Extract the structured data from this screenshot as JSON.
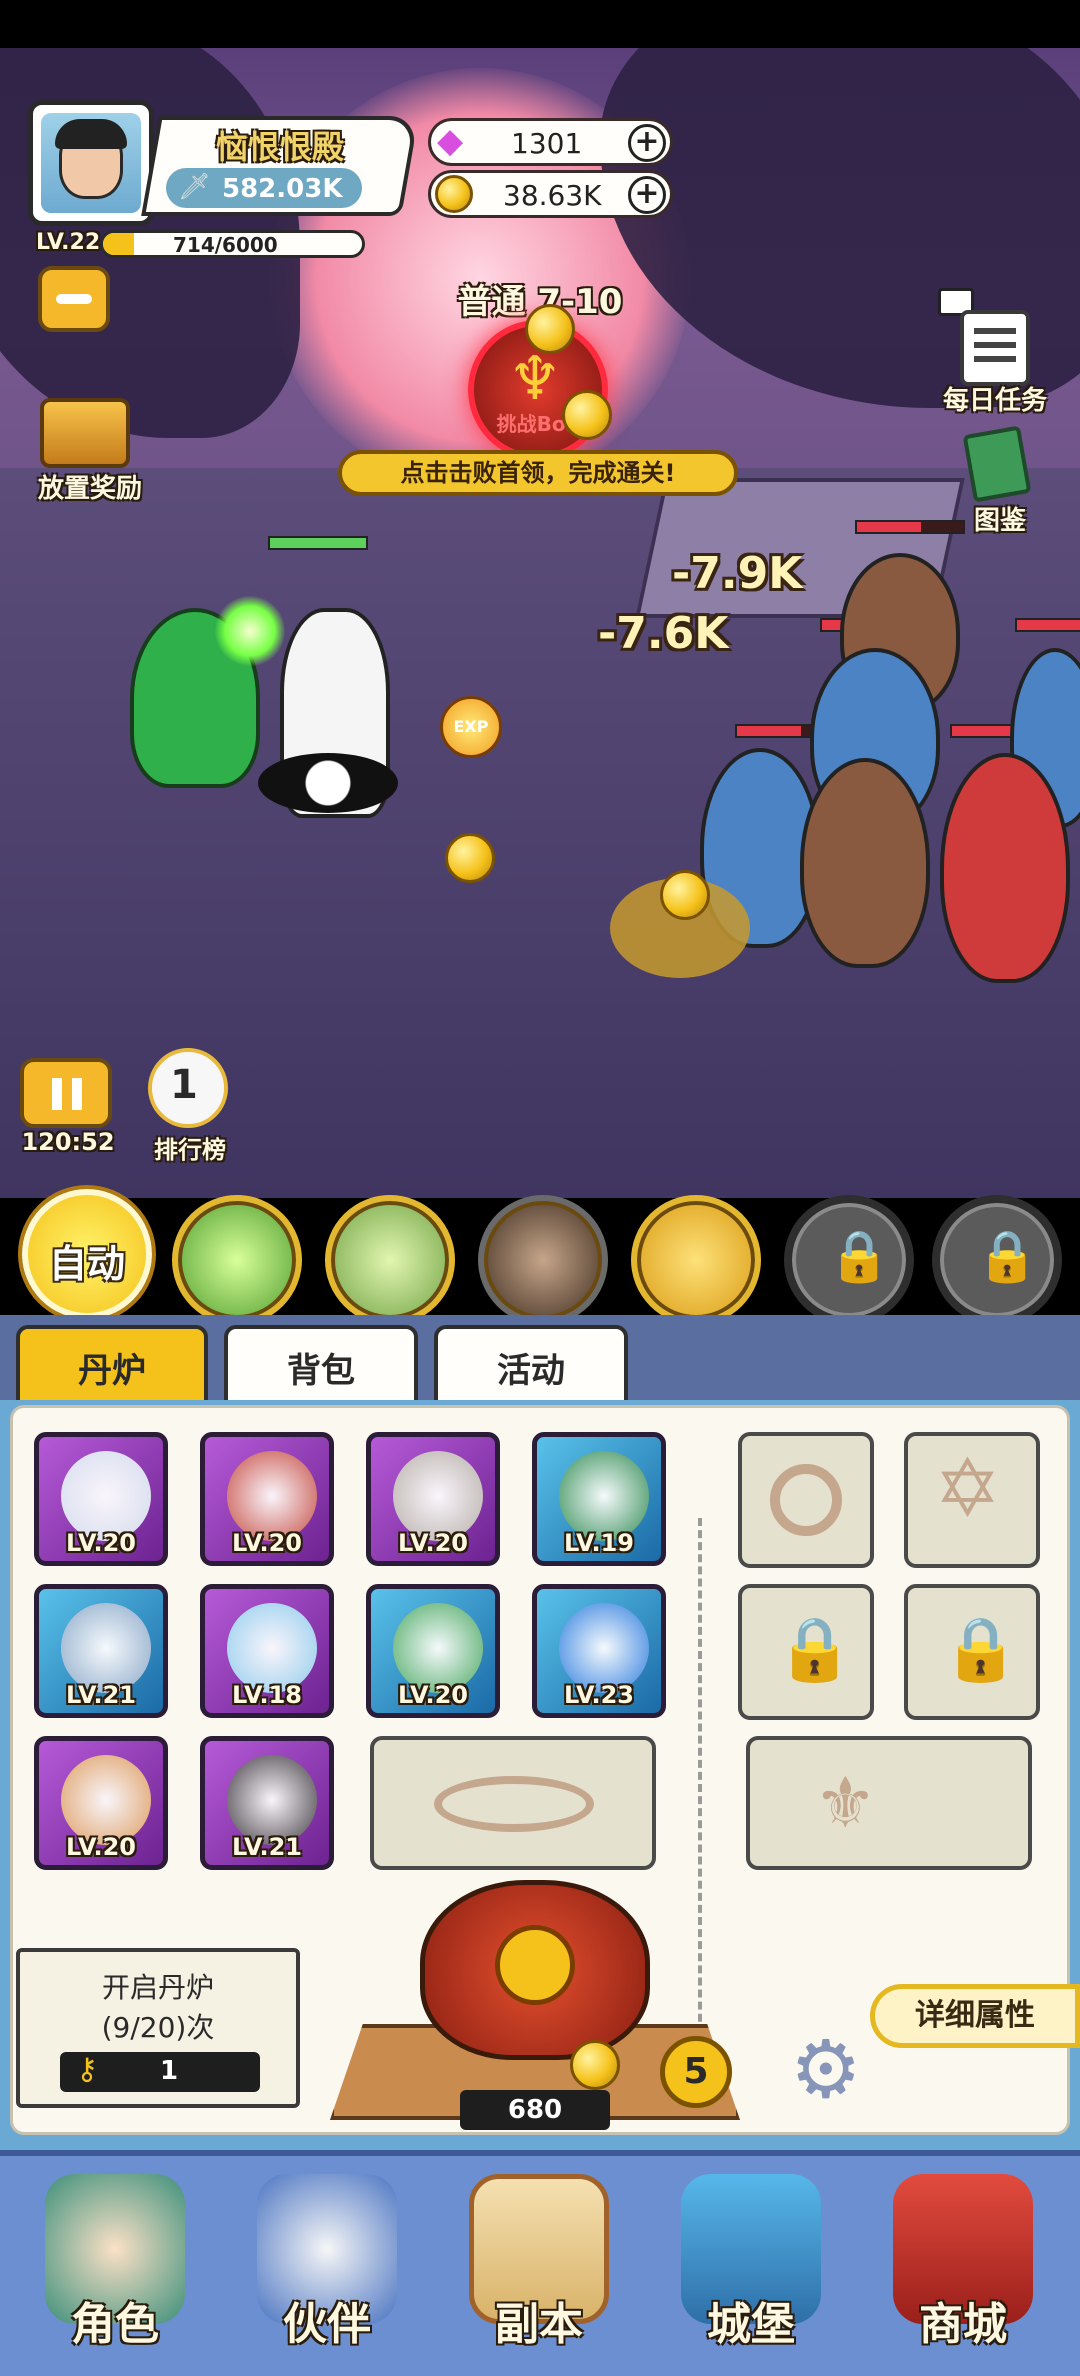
{
  "player": {
    "name": "恼恨恨殿",
    "power": "582.03K",
    "level": "LV.22",
    "exp": "714/6000",
    "exp_progress": 0.119
  },
  "currency": {
    "gems": "1301",
    "gold": "38.63K"
  },
  "stage": {
    "title": "普通 7-10",
    "boss_button": "挑战Boss",
    "hint": "点击击败首领，完成通关!"
  },
  "left_menu": {
    "idle_reward": "放置奖励"
  },
  "right_menu": {
    "daily_tasks": "每日任务",
    "codex": "图鉴"
  },
  "battle": {
    "damage_1": "-7.9K",
    "damage_2": "-7.6K",
    "exp_drop": "EXP",
    "timer": "120:52",
    "leaderboard": "排行榜"
  },
  "skills": {
    "auto_label": "自动"
  },
  "tabs": [
    {
      "label": "丹炉",
      "active": true
    },
    {
      "label": "背包",
      "active": false
    },
    {
      "label": "活动",
      "active": false
    }
  ],
  "items": [
    {
      "level": "LV.20",
      "rarity": "purple",
      "icon": "sword-icon"
    },
    {
      "level": "LV.20",
      "rarity": "purple",
      "icon": "boot-icon"
    },
    {
      "level": "LV.20",
      "rarity": "purple",
      "icon": "robe-icon"
    },
    {
      "level": "LV.19",
      "rarity": "blue",
      "icon": "dragon-orb-icon"
    },
    {
      "level": "LV.21",
      "rarity": "blue",
      "icon": "staff-icon"
    },
    {
      "level": "LV.18",
      "rarity": "purple",
      "icon": "swirl-orb-icon"
    },
    {
      "level": "LV.20",
      "rarity": "blue",
      "icon": "jade-pendant-icon"
    },
    {
      "level": "LV.23",
      "rarity": "blue",
      "icon": "water-orb-icon"
    },
    {
      "level": "LV.20",
      "rarity": "purple",
      "icon": "ring-icon"
    },
    {
      "level": "LV.21",
      "rarity": "purple",
      "icon": "boots-icon"
    }
  ],
  "furnace": {
    "open_title": "开启丹炉",
    "open_count": "(9/20)次",
    "keys": "1",
    "cost": "680",
    "level_badge": "5",
    "details_button": "详细属性"
  },
  "nav": [
    {
      "label": "角色",
      "icon": "character-icon"
    },
    {
      "label": "伙伴",
      "icon": "partner-icon"
    },
    {
      "label": "副本",
      "icon": "dungeon-icon"
    },
    {
      "label": "城堡",
      "icon": "castle-icon"
    },
    {
      "label": "商城",
      "icon": "shop-icon"
    }
  ],
  "colors": {
    "accent_gold": "#f5c21b",
    "purple_rarity": "#9b3fc4",
    "blue_rarity": "#2f8fd0",
    "nav_bg": "#6b8fd0",
    "panel_bg": "#6aa9d3"
  }
}
